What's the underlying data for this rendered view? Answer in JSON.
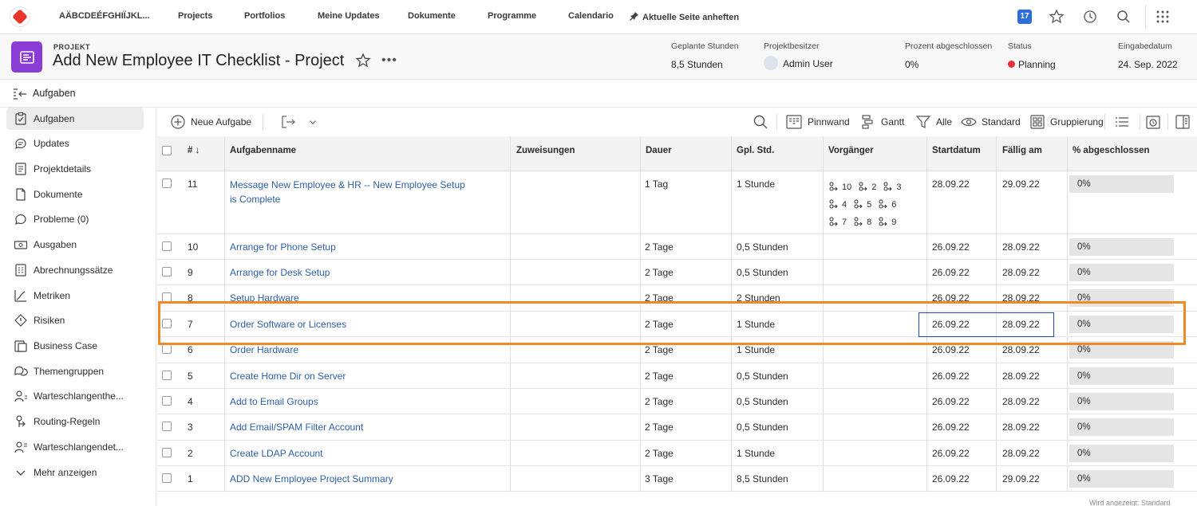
{
  "topnav": {
    "brand": "AÄBCDEÉFGHIÏJKL...",
    "items": [
      "Projects",
      "Portfolios",
      "Meine Updates",
      "Dokumente",
      "Programme",
      "Calendario"
    ],
    "pin_label": "Aktuelle Seite anheften",
    "notification_count": "17",
    "icons": [
      "star-icon",
      "history-icon",
      "search-icon",
      "grid-icon"
    ]
  },
  "project": {
    "label": "PROJEKT",
    "title": "Add New Employee IT Checklist - Project",
    "meta": [
      {
        "key": "Geplante Stunden",
        "value": "8,5 Stunden"
      },
      {
        "key": "Projektbesitzer",
        "value": "Admin User"
      },
      {
        "key": "Prozent abgeschlossen",
        "value": "0%"
      },
      {
        "key": "Status",
        "value": "Planning"
      },
      {
        "key": "Eingabedatum",
        "value": "24. Sep. 2022"
      }
    ],
    "status_color": "#e8313b",
    "accent_color": "#8a3dd4"
  },
  "subheader": {
    "title": "Aufgaben"
  },
  "sidebar": {
    "items": [
      {
        "label": "Aufgaben",
        "icon": "checklist-icon",
        "active": true
      },
      {
        "label": "Updates",
        "icon": "chat-icon"
      },
      {
        "label": "Projektdetails",
        "icon": "details-icon"
      },
      {
        "label": "Dokumente",
        "icon": "document-icon"
      },
      {
        "label": "Probleme (0)",
        "icon": "issue-icon"
      },
      {
        "label": "Ausgaben",
        "icon": "money-icon"
      },
      {
        "label": "Abrechnungssätze",
        "icon": "rates-icon"
      },
      {
        "label": "Metriken",
        "icon": "metrics-icon"
      },
      {
        "label": "Risiken",
        "icon": "risk-icon"
      },
      {
        "label": "Business Case",
        "icon": "business-case-icon"
      },
      {
        "label": "Themengruppen",
        "icon": "topic-groups-icon"
      },
      {
        "label": "Warteschlangenthe...",
        "icon": "queue-topics-icon"
      },
      {
        "label": "Routing-Regeln",
        "icon": "routing-icon"
      },
      {
        "label": "Warteschlangendet...",
        "icon": "queue-details-icon"
      },
      {
        "label": "Mehr anzeigen",
        "icon": "chevron-down-icon"
      }
    ]
  },
  "toolbar": {
    "new_task": "Neue Aufgabe",
    "views": [
      "Pinnwand",
      "Gantt",
      "Alle",
      "Standard",
      "Gruppierung"
    ]
  },
  "table": {
    "columns": [
      "#",
      "Aufgabenname",
      "Zuweisungen",
      "Dauer",
      "Gpl. Std.",
      "Vorgänger",
      "Startdatum",
      "Fällig am",
      "% abgeschlossen"
    ],
    "rows": [
      {
        "num": "11",
        "name": "Message New Employee & HR -- New Employee Setup is Complete",
        "duration": "1 Tag",
        "hours": "1 Stunde",
        "preds": [
          "10",
          "2",
          "3",
          "4",
          "5",
          "6",
          "7",
          "8",
          "9"
        ],
        "start": "28.09.22",
        "due": "29.09.22",
        "pct": "0%"
      },
      {
        "num": "10",
        "name": "Arrange for Phone Setup",
        "duration": "2 Tage",
        "hours": "0,5 Stunden",
        "start": "26.09.22",
        "due": "28.09.22",
        "pct": "0%"
      },
      {
        "num": "9",
        "name": "Arrange for Desk Setup",
        "duration": "2 Tage",
        "hours": "0,5 Stunden",
        "start": "26.09.22",
        "due": "28.09.22",
        "pct": "0%"
      },
      {
        "num": "8",
        "name": "Setup Hardware",
        "duration": "2 Tage",
        "hours": "2 Stunden",
        "start": "26.09.22",
        "due": "28.09.22",
        "pct": "0%"
      },
      {
        "num": "7",
        "name": "Order Software or Licenses",
        "duration": "2 Tage",
        "hours": "1 Stunde",
        "start": "26.09.22",
        "due": "28.09.22",
        "pct": "0%"
      },
      {
        "num": "6",
        "name": "Order Hardware",
        "duration": "2 Tage",
        "hours": "1 Stunde",
        "start": "26.09.22",
        "due": "28.09.22",
        "pct": "0%"
      },
      {
        "num": "5",
        "name": "Create Home Dir on Server",
        "duration": "2 Tage",
        "hours": "0,5 Stunden",
        "start": "26.09.22",
        "due": "28.09.22",
        "pct": "0%"
      },
      {
        "num": "4",
        "name": "Add to Email Groups",
        "duration": "2 Tage",
        "hours": "0,5 Stunden",
        "start": "26.09.22",
        "due": "28.09.22",
        "pct": "0%"
      },
      {
        "num": "3",
        "name": "Add Email/SPAM Filter Account",
        "duration": "2 Tage",
        "hours": "0,5 Stunden",
        "start": "26.09.22",
        "due": "28.09.22",
        "pct": "0%"
      },
      {
        "num": "2",
        "name": "Create LDAP Account",
        "duration": "2 Tage",
        "hours": "1 Stunde",
        "start": "26.09.22",
        "due": "28.09.22",
        "pct": "0%"
      },
      {
        "num": "1",
        "name": "ADD New Employee Project Summary",
        "duration": "3 Tage",
        "hours": "8,5 Stunden",
        "start": "26.09.22",
        "due": "29.09.22",
        "pct": "0%"
      }
    ]
  },
  "footer_note": "Wird angezeigt: Standard"
}
